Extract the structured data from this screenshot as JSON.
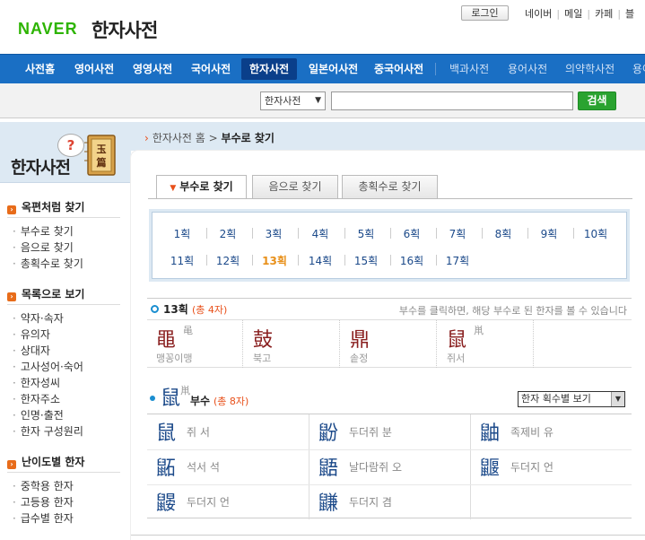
{
  "header": {
    "logo": "NAVER",
    "title": "한자사전",
    "login": "로그인",
    "links": [
      "네이버",
      "메일",
      "카페",
      "블"
    ]
  },
  "nav": {
    "items": [
      "사전홈",
      "영어사전",
      "영영사전",
      "국어사전",
      "한자사전",
      "일본어사전",
      "중국어사전",
      "백과사전",
      "용어사전",
      "의약학사전",
      "용어"
    ],
    "active": "한자사전"
  },
  "search": {
    "scope": "한자사전",
    "query": "",
    "button": "검색"
  },
  "sidebar": {
    "title": "한자사전",
    "book_label": "玉篇",
    "sections": [
      {
        "title": "옥편처럼 찾기",
        "items": [
          "부수로 찾기",
          "음으로 찾기",
          "총획수로 찾기"
        ]
      },
      {
        "title": "목록으로 보기",
        "items": [
          "약자·속자",
          "유의자",
          "상대자",
          "고사성어·숙어",
          "한자성씨",
          "한자주소",
          "인명·출전",
          "한자 구성원리"
        ]
      },
      {
        "title": "난이도별 한자",
        "items": [
          "중학용 한자",
          "고등용 한자",
          "급수별 한자"
        ]
      }
    ]
  },
  "breadcrumb": {
    "home": "한자사전 홈",
    "sep": ">",
    "current": "부수로 찾기"
  },
  "tabs": [
    "부수로 찾기",
    "음으로 찾기",
    "총획수로 찾기"
  ],
  "strokes": {
    "row1": [
      "1획",
      "2획",
      "3획",
      "4획",
      "5획",
      "6획",
      "7획",
      "8획",
      "9획",
      "10획"
    ],
    "row2": [
      "11획",
      "12획",
      "13획",
      "14획",
      "15획",
      "16획",
      "17획"
    ],
    "selected": "13획"
  },
  "radical_section": {
    "title": "13획",
    "count": "(총 4자)",
    "hint": "부수를 클릭하면, 해당 부수로 된 한자를 볼 수 있습니다",
    "radicals": [
      {
        "char": "黽",
        "small": "黾",
        "reading": "맹꽁이맹"
      },
      {
        "char": "鼓",
        "small": "",
        "reading": "북고"
      },
      {
        "char": "鼎",
        "small": "",
        "reading": "솥정"
      },
      {
        "char": "鼠",
        "small": "鼡",
        "reading": "쥐서"
      }
    ]
  },
  "char_section": {
    "big": "鼠",
    "small": "鼡",
    "label": "부수",
    "count": "(총 8자)",
    "sort": "한자 획수별 보기",
    "chars": [
      {
        "char": "鼠",
        "reading": "쥐 서"
      },
      {
        "char": "鼢",
        "reading": "두더쥐 분"
      },
      {
        "char": "鼬",
        "reading": "족제비 유"
      },
      {
        "char": "鼫",
        "reading": "석서 석"
      },
      {
        "char": "鼯",
        "reading": "날다람쥐 오"
      },
      {
        "char": "鼴",
        "reading": "두더지 언"
      },
      {
        "char": "鼹",
        "reading": "두더지 언"
      },
      {
        "char": "鼸",
        "reading": "두더지 겸"
      }
    ]
  },
  "colors": {
    "nav_bg": "#1a6fc4",
    "nav_active": "#0a3f8a",
    "accent": "#e8501a",
    "naver_green": "#2db400",
    "selected_stroke": "#e8901a"
  }
}
